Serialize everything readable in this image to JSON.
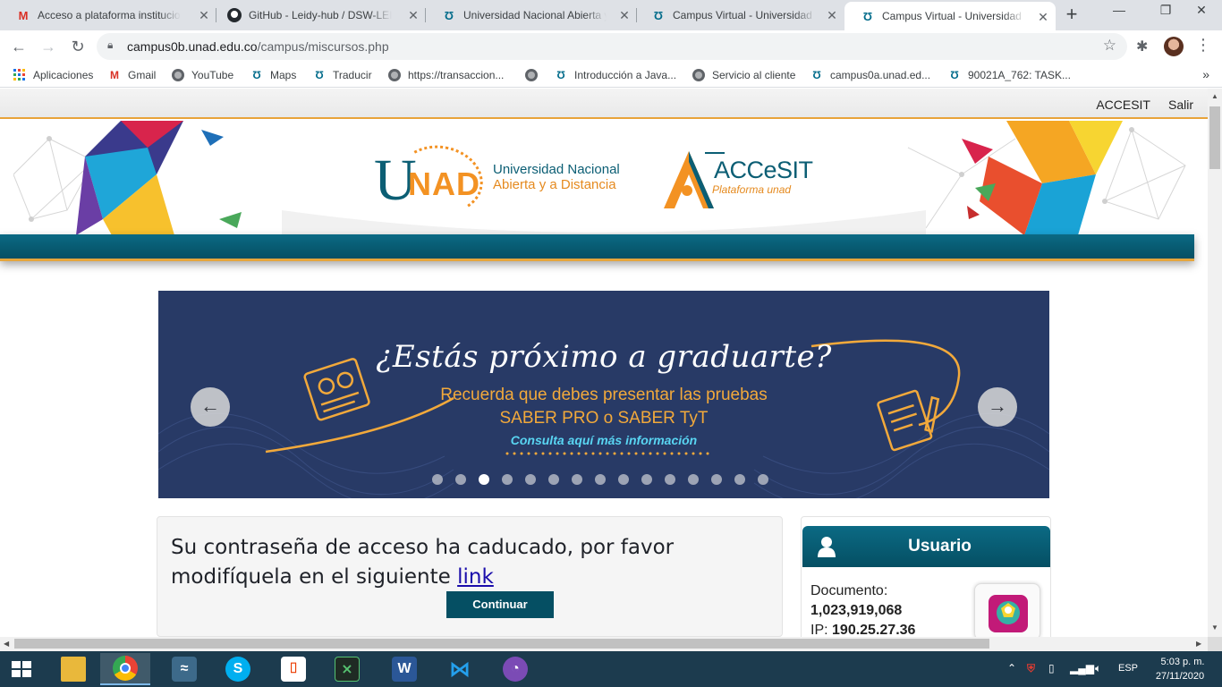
{
  "tabs": [
    {
      "title": "Acceso a plataforma institucional",
      "icon": "gmail-icon"
    },
    {
      "title": "GitHub - Leidy-hub / DSW-LEIDY",
      "icon": "github-icon"
    },
    {
      "title": "Universidad Nacional Abierta y a Distancia",
      "icon": "unad-icon"
    },
    {
      "title": "Campus Virtual - Universidad Nacional",
      "icon": "unad-icon"
    },
    {
      "title": "Campus Virtual - Universidad Nacional",
      "icon": "unad-icon",
      "active": true
    }
  ],
  "address": {
    "host": "campus0b.unad.edu.co",
    "path": "/campus/miscursos.php"
  },
  "bookmarks": [
    {
      "label": "Aplicaciones",
      "icon": "apps-grid-icon"
    },
    {
      "label": "Gmail",
      "icon": "gmail-icon"
    },
    {
      "label": "YouTube",
      "icon": "globe-icon"
    },
    {
      "label": "Maps",
      "icon": "unad-icon"
    },
    {
      "label": "Traducir",
      "icon": "unad-icon"
    },
    {
      "label": "https://transaccion...",
      "icon": "globe-icon"
    },
    {
      "label": "",
      "icon": "globe-icon"
    },
    {
      "label": "Introducción a Java...",
      "icon": "unad-icon"
    },
    {
      "label": "Servicio al cliente",
      "icon": "globe-icon"
    },
    {
      "label": "campus0a.unad.ed...",
      "icon": "unad-icon"
    },
    {
      "label": "90021A_762: TASK...",
      "icon": "unad-icon"
    }
  ],
  "site": {
    "top_links": {
      "accesit": "ACCESIT",
      "salir": "Salir"
    },
    "logo_unad_u": "U",
    "logo_unad_nad": "NAD",
    "university_line1": "Universidad Nacional",
    "university_line2": "Abierta y a Distancia",
    "accesit_logo": "ACCeSIT",
    "accesit_sub": "Plataforma unad"
  },
  "carousel": {
    "title": "¿Estás próximo a graduarte?",
    "line1": "Recuerda que debes presentar las pruebas",
    "line2": "SABER PRO o SABER TyT",
    "link": "Consulta aquí más información",
    "prev": "←",
    "next": "→",
    "slide_count": 15,
    "active_slide": 3
  },
  "notice": {
    "text": "Su contraseña de acceso ha caducado, por favor modifíquela en el siguiente",
    "link": "link",
    "button": "Continuar"
  },
  "user": {
    "title": "Usuario",
    "doc_label": "Documento:",
    "doc_value": "1,023,919,068",
    "ip_label": "IP:",
    "ip_value": "190.25.27.36"
  },
  "taskbar": {
    "lang": "ESP",
    "time": "5:03 p. m.",
    "date": "27/11/2020"
  },
  "colors": {
    "brand_teal": "#054f63",
    "brand_orange": "#f39223",
    "banner_bg": "#283a66"
  }
}
